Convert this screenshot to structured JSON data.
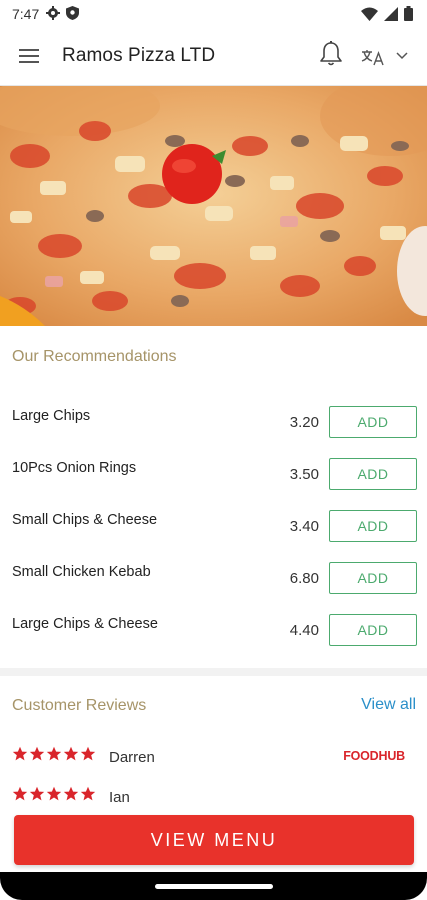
{
  "status_bar": {
    "time": "7:47",
    "left_icons": [
      "gear-icon",
      "shield-icon"
    ],
    "right_icons": [
      "wifi-icon",
      "signal-icon",
      "battery-icon"
    ]
  },
  "header": {
    "title": "Ramos Pizza LTD",
    "icons": [
      "menu-icon",
      "bell-icon",
      "language-icon",
      "chevron-down-icon"
    ]
  },
  "hero": {
    "image": "pizza-photo"
  },
  "recommendations": {
    "title": "Our Recommendations",
    "add_label": "ADD",
    "items": [
      {
        "name": "Large Chips",
        "price": "3.20"
      },
      {
        "name": "10Pcs Onion Rings",
        "price": "3.50"
      },
      {
        "name": "Small Chips & Cheese",
        "price": "3.40"
      },
      {
        "name": "Small Chicken Kebab",
        "price": "6.80"
      },
      {
        "name": "Large Chips & Cheese",
        "price": "4.40"
      }
    ]
  },
  "reviews": {
    "title": "Customer Reviews",
    "view_all": "View all",
    "source": "FOODHUB",
    "items": [
      {
        "name": "Darren",
        "stars": 5
      },
      {
        "name": "Ian",
        "stars": 5
      }
    ]
  },
  "view_menu": {
    "label": "VIEW MENU"
  },
  "colors": {
    "accent_red": "#e8322b",
    "add_green": "#4caa6e",
    "section_gold": "#a69468",
    "link_blue": "#2a8fc9",
    "star_red": "#d9252b"
  }
}
